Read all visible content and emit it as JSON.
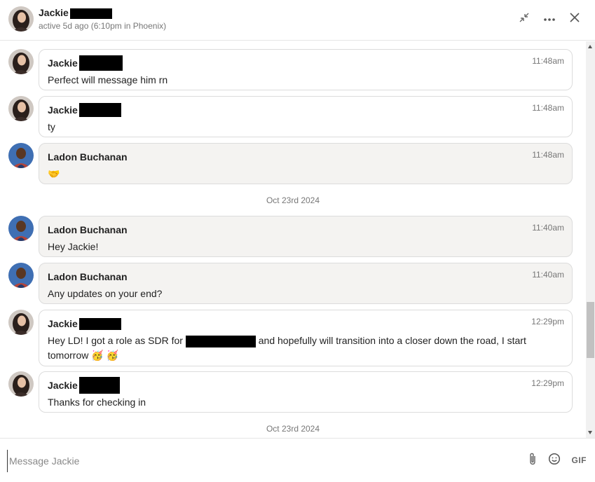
{
  "header": {
    "name": "Jackie",
    "status": "active 5d ago (6:10pm in Phoenix)"
  },
  "messages": [
    {
      "sender": "Jackie",
      "time": "11:48am",
      "text": "Perfect will message him rn",
      "mine": true
    },
    {
      "sender": "Jackie",
      "time": "11:48am",
      "text": "ty",
      "mine": true
    },
    {
      "sender": "Ladon Buchanan",
      "time": "11:48am",
      "text": "🤝",
      "mine": false
    }
  ],
  "date_separators": [
    "Oct 23rd 2024",
    "Oct 23rd 2024"
  ],
  "messages2": [
    {
      "sender": "Ladon Buchanan",
      "time": "11:40am",
      "text": "Hey Jackie!"
    },
    {
      "sender": "Ladon Buchanan",
      "time": "11:40am",
      "text": "Any updates on your end?"
    },
    {
      "sender": "Jackie",
      "time": "12:29pm",
      "text_before": "Hey LD! I got a role as SDR for",
      "text_after": "and hopefully will transition into a closer down the road, I start tomorrow 🥳 🥳"
    },
    {
      "sender": "Jackie",
      "time": "12:29pm",
      "text": "Thanks for checking in"
    }
  ],
  "composer": {
    "placeholder": "Message Jackie",
    "gif_label": "GIF"
  },
  "icons": {
    "minimize": "collapse-arrows-icon",
    "more": "more-horizontal-icon",
    "close": "close-icon",
    "attach": "paperclip-icon",
    "emoji": "emoji-icon"
  },
  "colors": {
    "other_bubble": "#f4f3f1",
    "own_bubble": "#ffffff",
    "redaction": "#000000"
  }
}
